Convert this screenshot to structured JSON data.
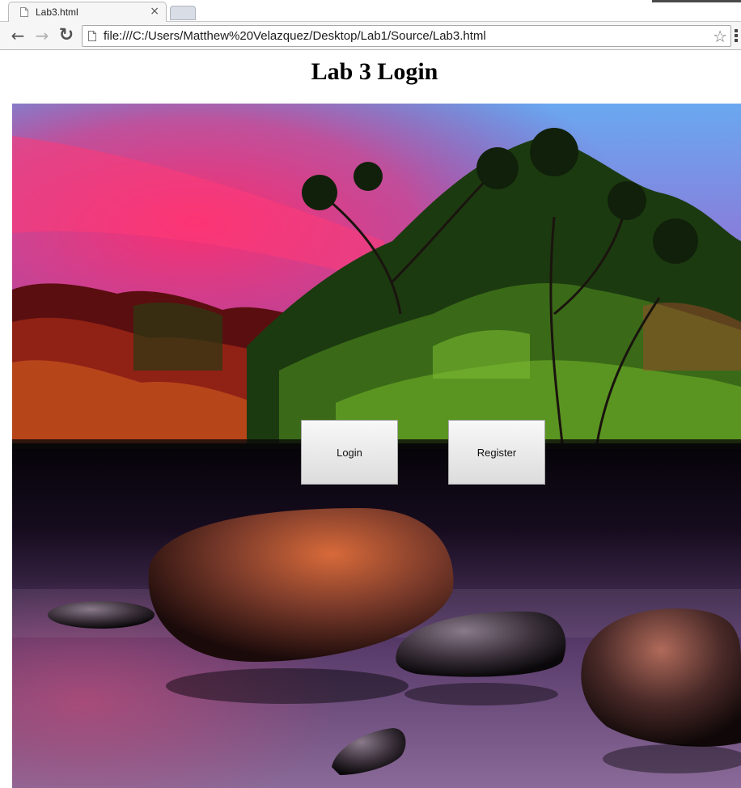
{
  "browser": {
    "tab_title": "Lab3.html",
    "tab_close": "×",
    "url": "file:///C:/Users/Matthew%20Velazquez/Desktop/Lab1/Source/Lab3.html",
    "back_icon": "←",
    "forward_icon": "→",
    "reload_icon": "↻",
    "bookmark_icon": "☆"
  },
  "page": {
    "title": "Lab 3 Login",
    "background_image": "lake-sunset-with-trees-and-rocks",
    "buttons": {
      "login": "Login",
      "register": "Register"
    }
  },
  "colors": {
    "sky_top": "#6aa8f0",
    "sky_pink": "#ff3a78",
    "water_dark": "#0a0612",
    "water_purple": "#7a5a8c"
  }
}
